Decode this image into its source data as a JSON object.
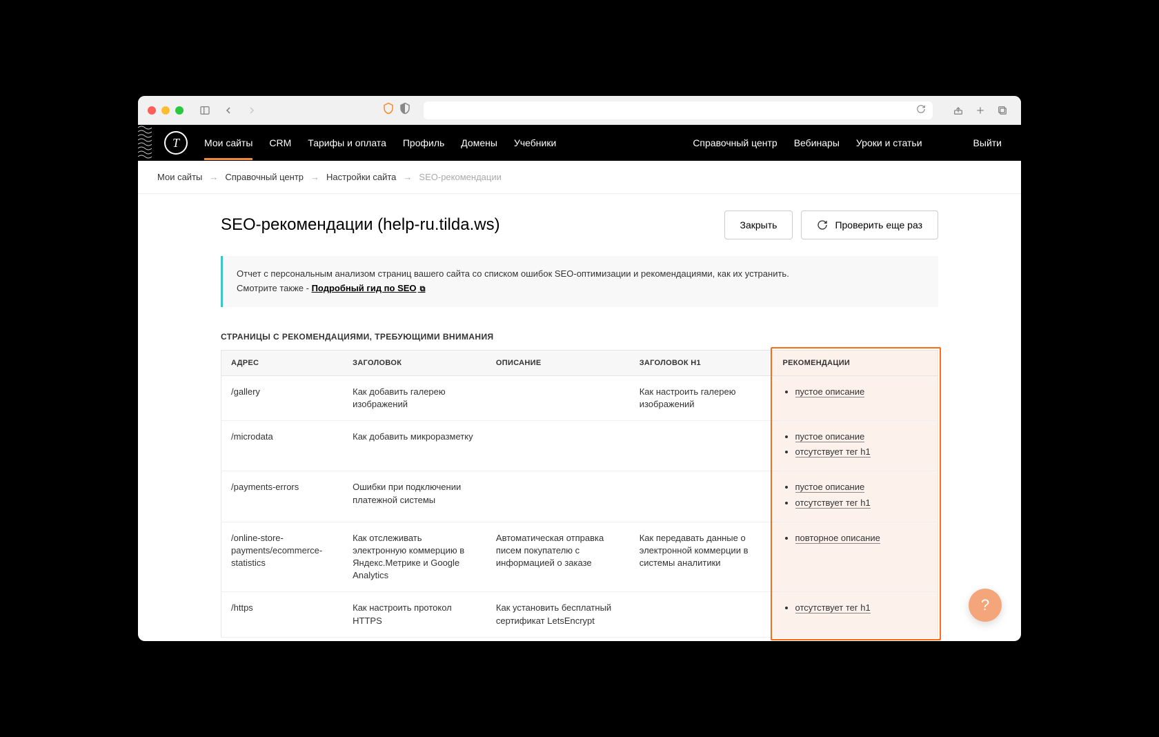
{
  "nav": {
    "left": [
      "Мои сайты",
      "CRM",
      "Тарифы и оплата",
      "Профиль",
      "Домены",
      "Учебники"
    ],
    "right": [
      "Справочный центр",
      "Вебинары",
      "Уроки и статьи"
    ],
    "logout": "Выйти",
    "active_index": 0
  },
  "breadcrumb": {
    "items": [
      "Мои сайты",
      "Справочный центр",
      "Настройки сайта",
      "SEO-рекомендации"
    ]
  },
  "header": {
    "title": "SEO-рекомендации (help-ru.tilda.ws)",
    "close_btn": "Закрыть",
    "recheck_btn": "Проверить еще раз"
  },
  "info": {
    "line1": "Отчет с персональным анализом страниц вашего сайта со списком ошибок SEO-оптимизации и рекомендациями, как их устранить.",
    "line2_prefix": "Смотрите также - ",
    "link_text": "Подробный гид по SEO"
  },
  "section_title": "СТРАНИЦЫ С РЕКОМЕНДАЦИЯМИ, ТРЕБУЮЩИМИ ВНИМАНИЯ",
  "table": {
    "headers": {
      "address": "АДРЕС",
      "title": "ЗАГОЛОВОК",
      "description": "ОПИСАНИЕ",
      "h1": "ЗАГОЛОВОК H1",
      "recommendations": "РЕКОМЕНДАЦИИ"
    },
    "rows": [
      {
        "address": "/gallery",
        "title": "Как добавить галерею изображений",
        "description": "",
        "h1": "Как настроить галерею изображений",
        "recs": [
          "пустое описание"
        ]
      },
      {
        "address": "/microdata",
        "title": "Как добавить микроразметку",
        "description": "",
        "h1": "",
        "recs": [
          "пустое описание",
          "отсутствует тег h1"
        ]
      },
      {
        "address": "/payments-errors",
        "title": "Ошибки при подключении платежной системы",
        "description": "",
        "h1": "",
        "recs": [
          "пустое описание",
          "отсутствует тег h1"
        ]
      },
      {
        "address": "/online-store-payments/ecommerce-statistics",
        "title": "Как отслеживать электронную коммерцию в Яндекс.Метрике и Google Analytics",
        "description": "Автоматическая отправка писем покупателю с информацией о заказе",
        "h1": "Как передавать данные о электронной коммерции в системы аналитики",
        "recs": [
          "повторное описание"
        ]
      },
      {
        "address": "/https",
        "title": "Как настроить протокол HTTPS",
        "description": "Как установить бесплатный сертификат LetsEncrypt",
        "h1": "",
        "recs": [
          "отсутствует тег h1"
        ]
      }
    ]
  },
  "help_fab": "?"
}
